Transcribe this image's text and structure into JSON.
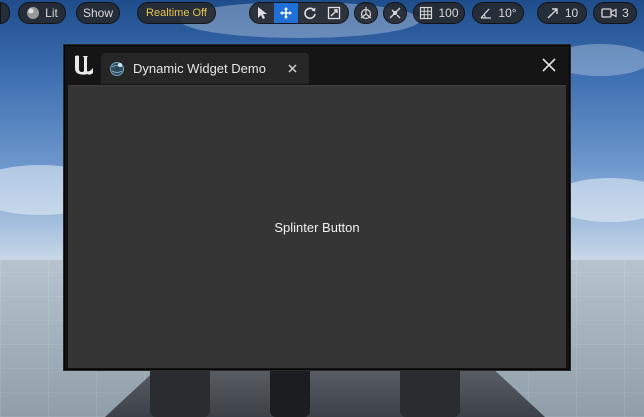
{
  "toolbar": {
    "lit_label": "Lit",
    "show_label": "Show",
    "realtime_label": "Realtime Off",
    "grid_value": "100",
    "angle_value": "10°",
    "scale_value": "10",
    "camera_speed_value": "3",
    "transform_tools": [
      {
        "name": "select",
        "icon": "cursor-icon",
        "active": false
      },
      {
        "name": "translate",
        "icon": "move-arrows-icon",
        "active": true
      },
      {
        "name": "rotate",
        "icon": "rotate-icon",
        "active": false
      },
      {
        "name": "scale",
        "icon": "scale-icon",
        "active": false
      }
    ],
    "accent_color": "#1f6fd6",
    "realtime_color": "#e9c64a"
  },
  "window": {
    "tab_title": "Dynamic Widget Demo",
    "close_glyph": "×",
    "content_button_label": "Splinter Button"
  }
}
